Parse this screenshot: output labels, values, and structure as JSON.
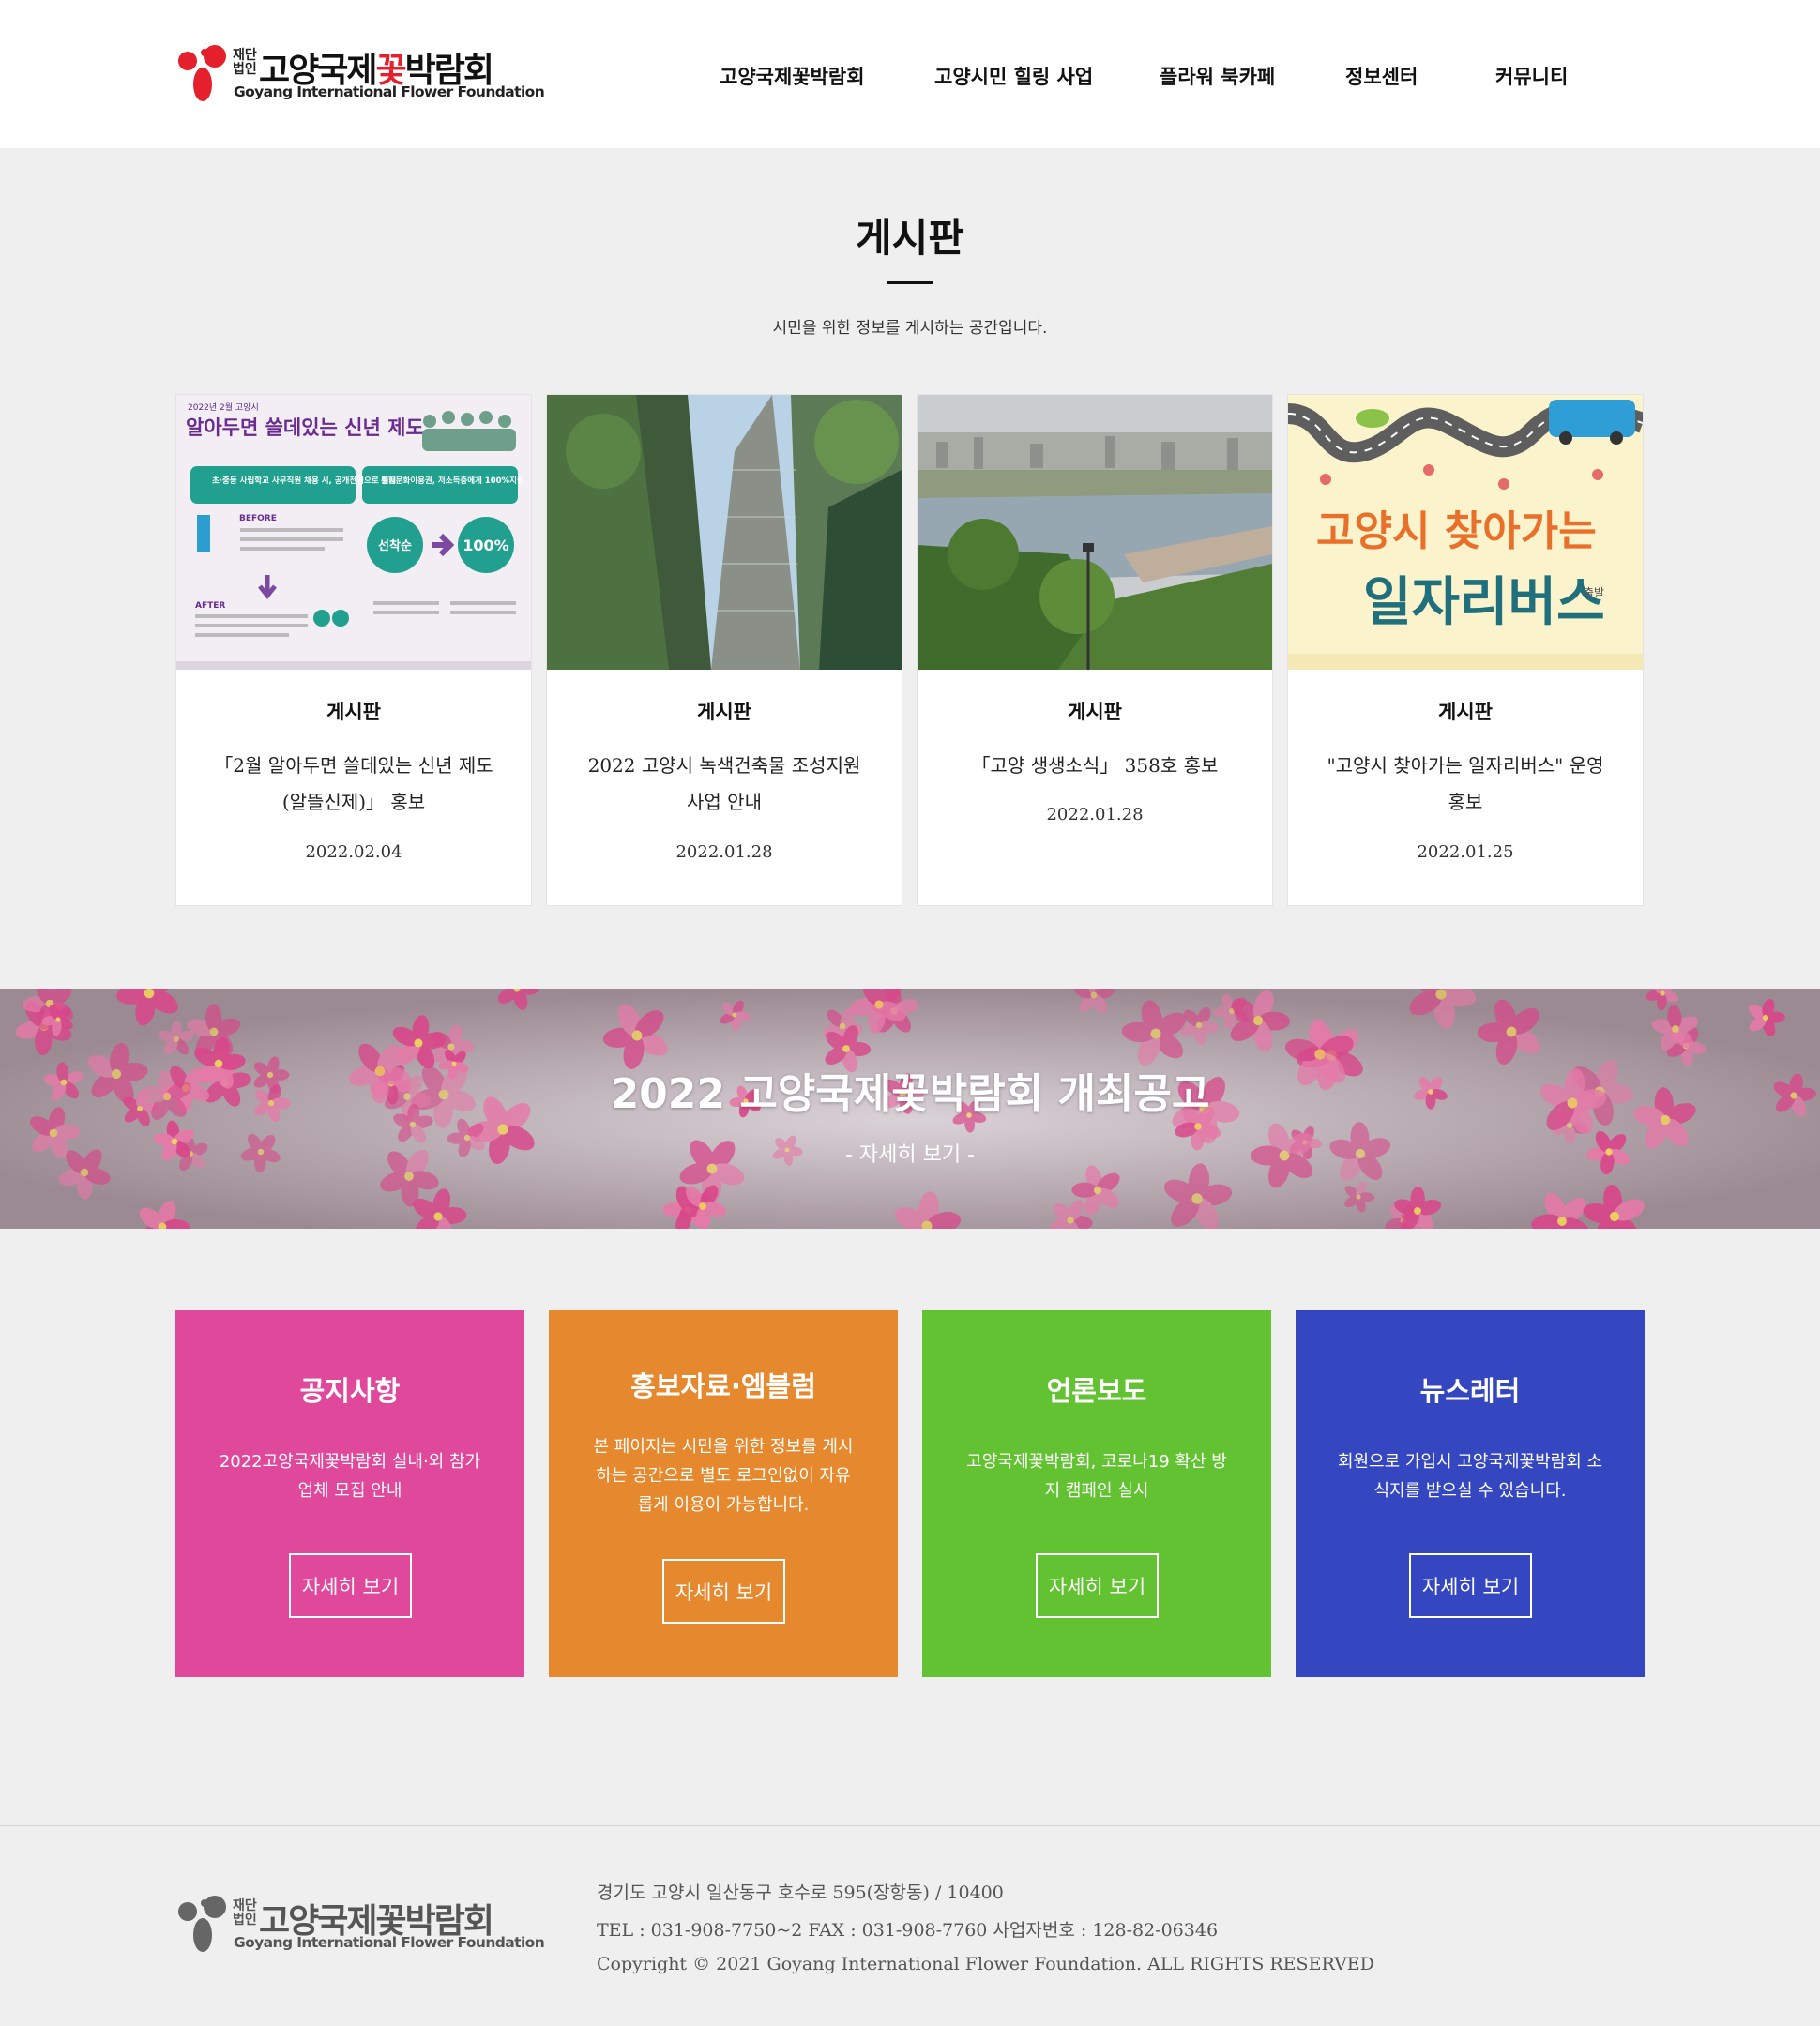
{
  "header": {
    "logo": {
      "small": "재단 법인",
      "name_a": "고양국제",
      "name_b": "꽃",
      "name_c": "박람회",
      "english": "Goyang International Flower Foundation"
    },
    "nav": [
      "고양국제꽃박람회",
      "고양시민 힐링 사업",
      "플라워 북카페",
      "정보센터",
      "커뮤니티"
    ]
  },
  "board": {
    "title": "게시판",
    "subtitle": "시민을 위한 정보를 게시하는 공간입니다.",
    "cards": [
      {
        "category": "게시판",
        "title": "「2월 알아두면 쓸데있는 신년 제도(알뜰신제)」 홍보",
        "date": "2022.02.04",
        "image": {
          "top": "2022년 2월 고양시",
          "headline": "알아두면 쓸데있는 신년 제도",
          "left_head": "초·중등 사립학교 사무직원 채용 시, 공개전형으로 실시",
          "right_head": "통합문화이용권, 저소득층에게 100%지원",
          "before": "BEFORE",
          "after": "AFTER",
          "first_come": "선착순",
          "full": "100%"
        }
      },
      {
        "category": "게시판",
        "title": "2022 고양시 녹색건축물 조성지원 사업 안내",
        "date": "2022.01.28"
      },
      {
        "category": "게시판",
        "title": "「고양 생생소식」 358호 홍보",
        "date": "2022.01.28"
      },
      {
        "category": "게시판",
        "title": "\"고양시 찾아가는 일자리버스\" 운영 홍보",
        "date": "2022.01.25",
        "image": {
          "line1": "고양시 찾아가는",
          "line2": "일자리버스",
          "tag": "출발"
        }
      }
    ]
  },
  "banner": {
    "title": "2022 고양국제꽃박람회 개최공고",
    "link": "- 자세히 보기 -"
  },
  "tiles": [
    {
      "title": "공지사항",
      "desc": "2022고양국제꽃박람회 실내·외 참가 업체 모집 안내",
      "button": "자세히 보기",
      "color": "#e0489b"
    },
    {
      "title": "홍보자료·엠블럼",
      "desc": "본 페이지는 시민을 위한 정보를 게시하는 공간으로 별도 로그인없이 자유롭게 이용이 가능합니다.",
      "button": "자세히 보기",
      "color": "#e6892e"
    },
    {
      "title": "언론보도",
      "desc": "고양국제꽃박람회, 코로나19 확산 방지 캠페인 실시",
      "button": "자세히 보기",
      "color": "#62c232"
    },
    {
      "title": "뉴스레터",
      "desc": "회원으로 가입시 고양국제꽃박람회 소식지를 받으실 수 있습니다.",
      "button": "자세히 보기",
      "color": "#3447c1"
    }
  ],
  "footer": {
    "address": "경기도 고양시 일산동구 호수로 595(장항동) / 10400",
    "tel": "TEL : 031-908-7750~2 FAX : 031-908-7760 사업자번호 : 128-82-06346",
    "copyright": "Copyright © 2021 Goyang International Flower Foundation. ALL RIGHTS RESERVED"
  },
  "colors": {
    "brand_red": "#e3202b",
    "page_bg": "#efefef",
    "footer_logo_gray": "#666666"
  }
}
